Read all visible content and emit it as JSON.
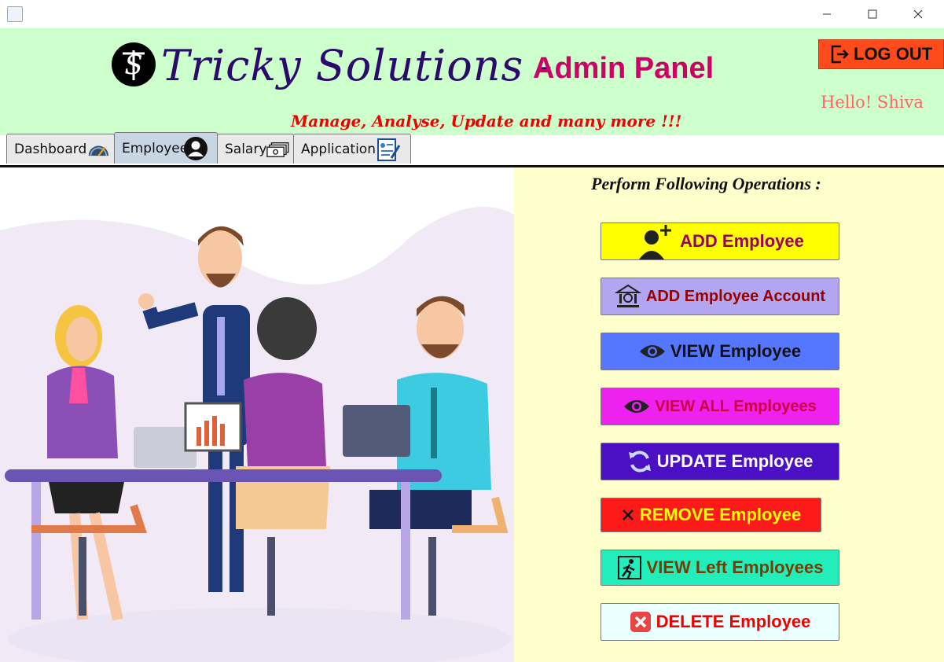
{
  "window": {
    "controls": {
      "minimize_icon": "minimize-icon",
      "maximize_icon": "maximize-icon",
      "close_icon": "close-icon"
    }
  },
  "header": {
    "brand": "Tricky Solutions  -",
    "subtitle": "Admin Panel",
    "tagline": "Manage, Analyse, Update and many more !!!",
    "logout_label": "LOG OUT",
    "greeting": "Hello! Shiva",
    "colors": {
      "background": "#ccffcc",
      "brand": "#2b0a6b",
      "subtitle": "#cc0066",
      "tagline": "#ee0000",
      "logout": "#ff4a1c",
      "greeting": "#ff6666"
    }
  },
  "tabs": [
    {
      "label": "Dashboard",
      "icon": "speedometer-icon",
      "active": false
    },
    {
      "label": "Employee",
      "icon": "person-icon",
      "active": true
    },
    {
      "label": "Salary",
      "icon": "cash-icon",
      "active": false
    },
    {
      "label": "Application",
      "icon": "form-icon",
      "active": false
    }
  ],
  "operations_panel": {
    "title": "Perform Following Operations :",
    "background": "#ffffcc",
    "buttons": [
      {
        "label": "ADD Employee",
        "icon": "add-person-icon",
        "bg": "#ffff00",
        "fg": "#990066"
      },
      {
        "label": "ADD Employee Account",
        "icon": "bank-icon",
        "bg": "#b3a6f0",
        "fg": "#990000"
      },
      {
        "label": "VIEW Employee",
        "icon": "eye-icon",
        "bg": "#5577ff",
        "fg": "#111111"
      },
      {
        "label": "VIEW ALL Employees",
        "icon": "eye-icon",
        "bg": "#ee22ee",
        "fg": "#cc0044"
      },
      {
        "label": "UPDATE Employee",
        "icon": "refresh-icon",
        "bg": "#4b0fc4",
        "fg": "#ffffff"
      },
      {
        "label": "REMOVE Employee",
        "icon": "cross-icon",
        "bg": "#ff1a1a",
        "fg": "#ffff00"
      },
      {
        "label": "VIEW Left Employees",
        "icon": "exit-person-icon",
        "bg": "#22eebb",
        "fg": "#7a3b00"
      },
      {
        "label": "DELETE Employee",
        "icon": "delete-box-icon",
        "bg": "#eaffff",
        "fg": "#ee0000"
      }
    ]
  },
  "illustration": {
    "description_icon": "team-meeting-illustration"
  }
}
